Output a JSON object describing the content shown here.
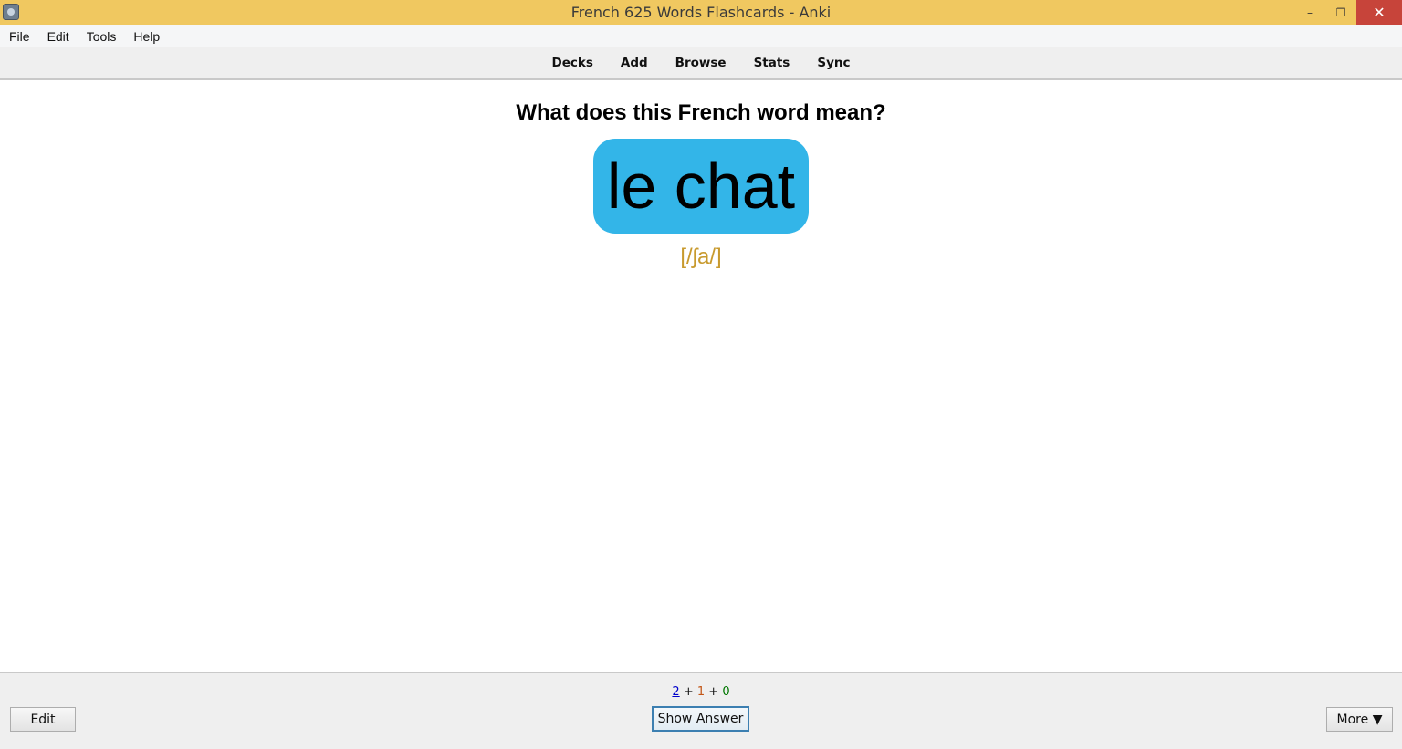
{
  "window": {
    "title": "French 625 Words Flashcards - Anki",
    "minimize_glyph": "–",
    "restore_glyph": "❐",
    "close_glyph": "✕"
  },
  "menu": {
    "items": [
      "File",
      "Edit",
      "Tools",
      "Help"
    ]
  },
  "toolbar": {
    "links": [
      "Decks",
      "Add",
      "Browse",
      "Stats",
      "Sync"
    ]
  },
  "card": {
    "question": "What does this French word mean?",
    "word": "le chat",
    "pronunciation": "[/ʃa/]",
    "bubble_color": "#33b5e8",
    "pronunciation_color": "#c89a2e"
  },
  "bottom": {
    "counts": {
      "new": "2",
      "sep1": " + ",
      "learn": "1",
      "sep2": " + ",
      "review": "0"
    },
    "edit_label": "Edit",
    "show_answer_label": "Show Answer",
    "more_label": "More ▼"
  },
  "colors": {
    "titlebar": "#f0c860",
    "close_button": "#c7443a",
    "count_new": "#0000cc",
    "count_learn": "#c35617",
    "count_review": "#007700"
  }
}
